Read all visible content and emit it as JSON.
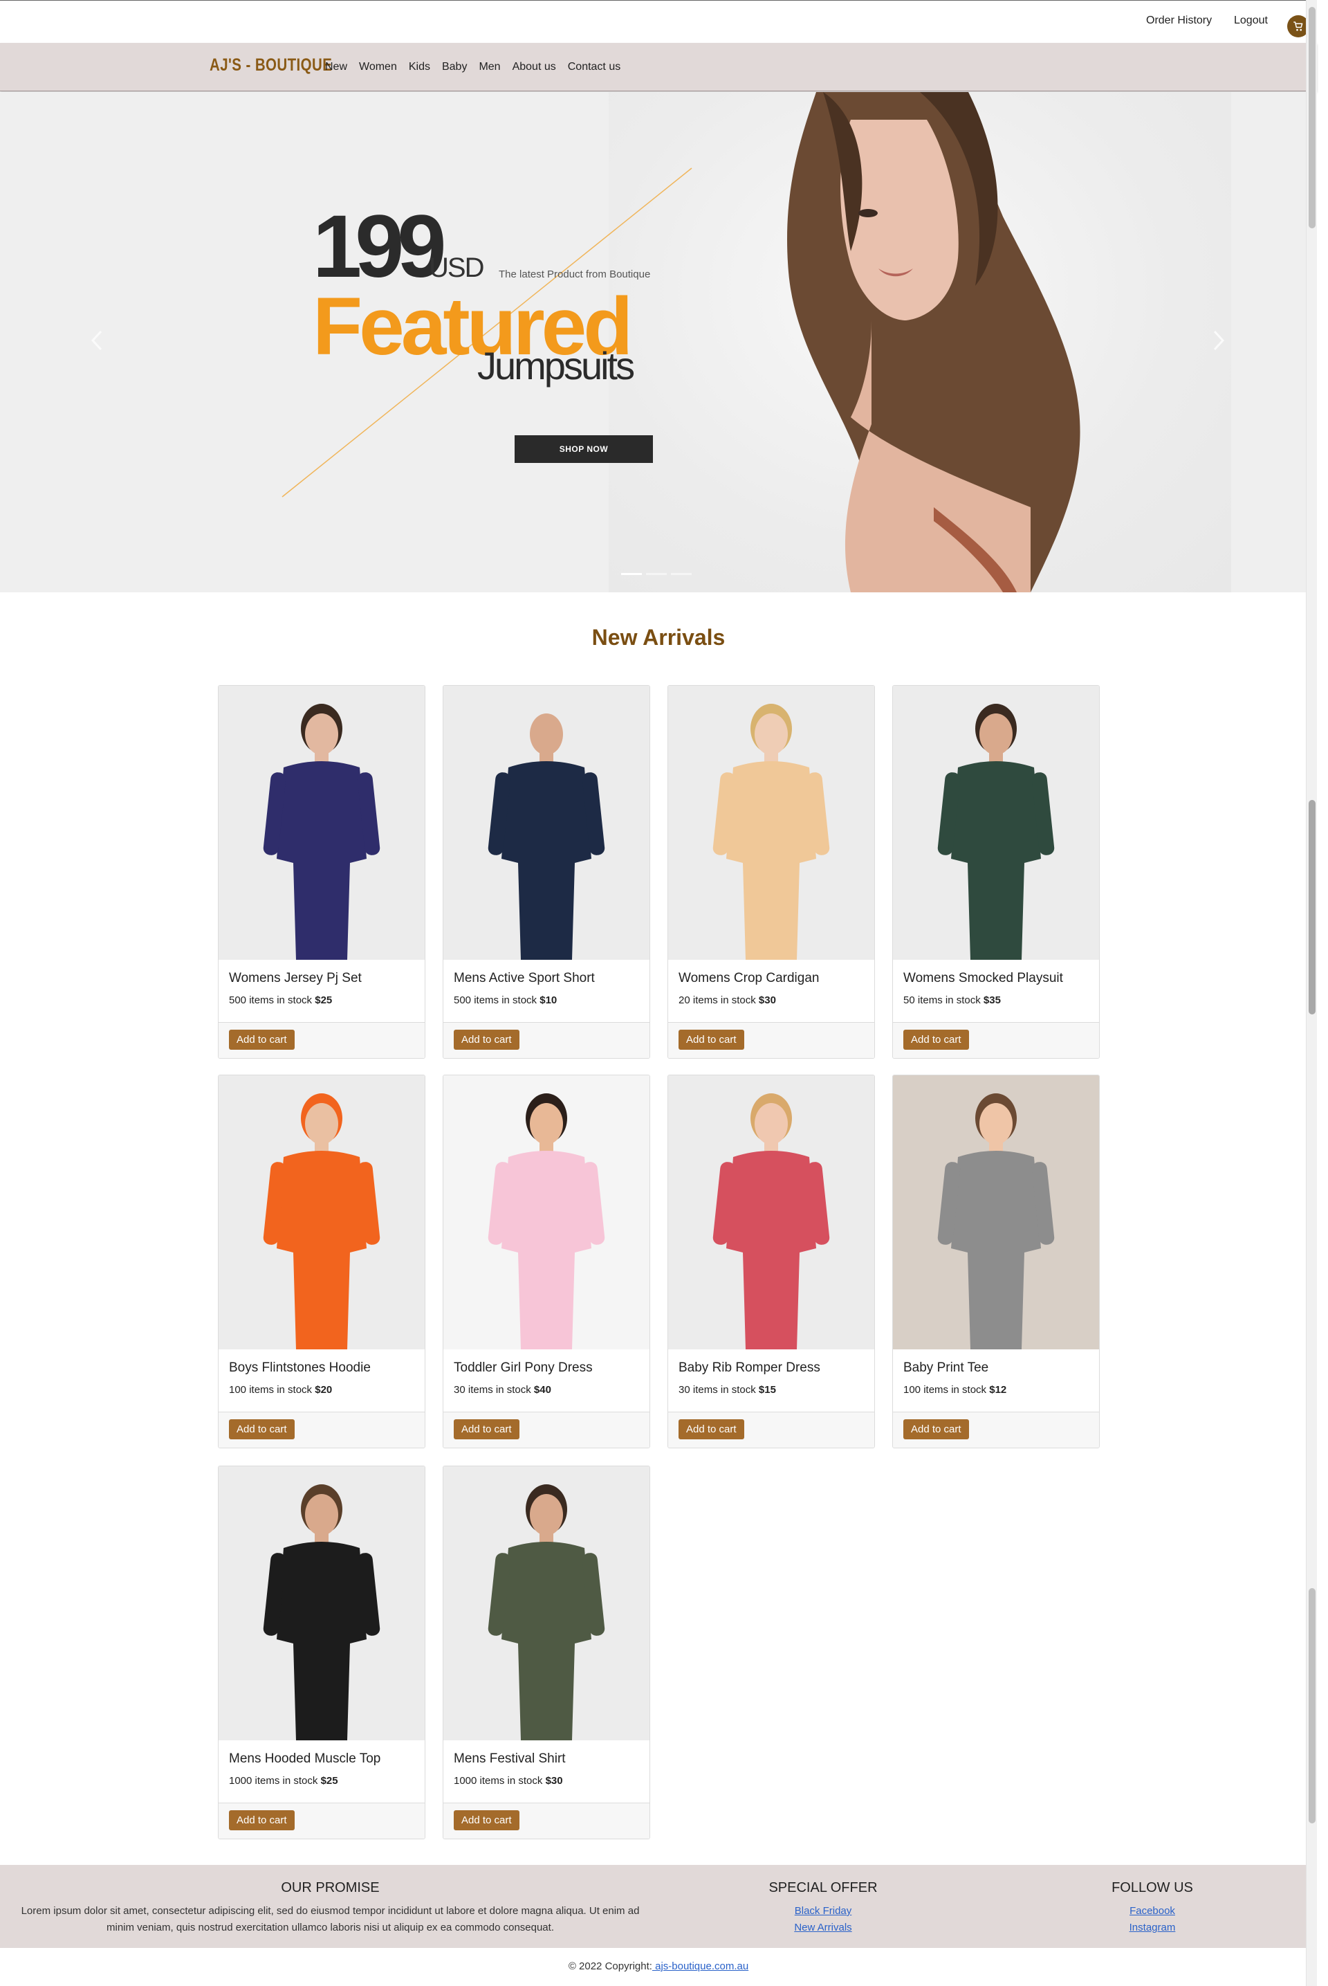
{
  "topbar": {
    "order_history": "Order History",
    "logout": "Logout",
    "cart_icon": "cart-icon"
  },
  "nav": {
    "brand": "AJ'S - BOUTIQUE",
    "links": [
      "New",
      "Women",
      "Kids",
      "Baby",
      "Men",
      "About us",
      "Contact us"
    ]
  },
  "hero": {
    "price": "199",
    "currency": "USD",
    "tagline": "The latest Product from Boutique",
    "headline": "Featured",
    "subheadline": "Jumpsuits",
    "cta": "SHOP NOW",
    "prev_icon": "chevron-left-icon",
    "next_icon": "chevron-right-icon",
    "slide_count": 3,
    "active_slide": 1
  },
  "new_arrivals": {
    "title": "New Arrivals",
    "add_label": "Add to cart",
    "stock_suffix": "items in stock",
    "products": [
      {
        "name": "Womens Jersey Pj Set",
        "stock": "500",
        "price": "$25"
      },
      {
        "name": "Mens Active Sport Short",
        "stock": "500",
        "price": "$10"
      },
      {
        "name": "Womens Crop Cardigan",
        "stock": "20",
        "price": "$30"
      },
      {
        "name": "Womens Smocked Playsuit",
        "stock": "50",
        "price": "$35"
      },
      {
        "name": "Boys Flintstones Hoodie",
        "stock": "100",
        "price": "$20"
      },
      {
        "name": "Toddler Girl Pony Dress",
        "stock": "30",
        "price": "$40"
      },
      {
        "name": "Baby Rib Romper Dress",
        "stock": "30",
        "price": "$15"
      },
      {
        "name": "Baby Print Tee",
        "stock": "100",
        "price": "$12"
      },
      {
        "name": "Mens Hooded Muscle Top",
        "stock": "1000",
        "price": "$25"
      },
      {
        "name": "Mens Festival Shirt",
        "stock": "1000",
        "price": "$30"
      }
    ]
  },
  "footer": {
    "promise_title": "OUR PROMISE",
    "promise_text": "Lorem ipsum dolor sit amet, consectetur adipiscing elit, sed do eiusmod tempor incididunt ut labore et dolore magna aliqua. Ut enim ad minim veniam, quis nostrud exercitation ullamco laboris nisi ut aliquip ex ea commodo consequat.",
    "offer_title": "SPECIAL OFFER",
    "offer_links": [
      "Black Friday",
      "New Arrivals"
    ],
    "follow_title": "FOLLOW US",
    "follow_links": [
      "Facebook",
      "Instagram"
    ],
    "copyright": "© 2022 Copyright:",
    "copyright_link": " ajs-boutique.com.au"
  },
  "colors": {
    "brand": "#8a5a16",
    "nav_bg": "#e1d9d8",
    "button": "#a46b2b",
    "accent_orange": "#f39a1c",
    "link": "#2a62c9"
  }
}
